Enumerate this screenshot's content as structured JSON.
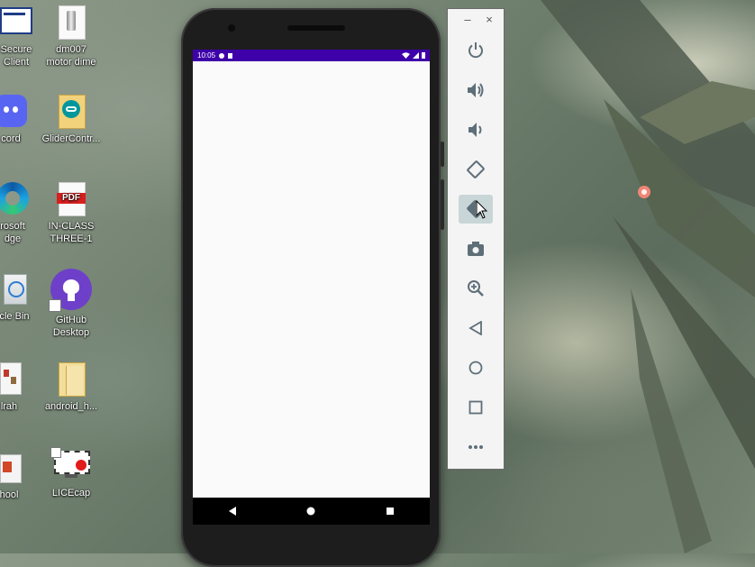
{
  "desktop": {
    "icons": [
      {
        "label_line1": "Secure",
        "label_line2": "Client",
        "icon": "cisco-vpn-icon"
      },
      {
        "label_line1": "dm007",
        "label_line2": "motor dime",
        "icon": "motor-file-icon"
      },
      {
        "label_line1": "cord",
        "label_line2": "",
        "icon": "discord-icon"
      },
      {
        "label_line1": "GliderContr...",
        "label_line2": "",
        "icon": "arduino-folder-icon"
      },
      {
        "label_line1": "rosoft",
        "label_line2": "dge",
        "icon": "edge-icon"
      },
      {
        "label_line1": "IN-CLASS",
        "label_line2": "THREE-1",
        "icon": "pdf-icon"
      },
      {
        "label_line1": "cle Bin",
        "label_line2": "",
        "icon": "recycle-bin-icon"
      },
      {
        "label_line1": "GitHub",
        "label_line2": "Desktop",
        "icon": "github-icon"
      },
      {
        "label_line1": "lrah",
        "label_line2": "",
        "icon": "document-stack-icon"
      },
      {
        "label_line1": "android_h...",
        "label_line2": "",
        "icon": "folder-icon"
      },
      {
        "label_line1": "hool",
        "label_line2": "",
        "icon": "school-folder-icon"
      },
      {
        "label_line1": "LICEcap",
        "label_line2": "",
        "icon": "licecap-icon"
      }
    ]
  },
  "phone": {
    "status": {
      "time": "10:05"
    },
    "colors": {
      "status_bar": "#3e00a8",
      "screen_bg": "#fafafa",
      "nav_bar": "#000000"
    },
    "nav": {
      "back": "back-icon",
      "home": "home-icon",
      "recents": "recents-icon"
    }
  },
  "emulator_toolbar": {
    "minimize": "–",
    "close": "×",
    "buttons": [
      {
        "name": "power-icon"
      },
      {
        "name": "volume-up-icon"
      },
      {
        "name": "volume-down-icon"
      },
      {
        "name": "rotate-left-icon"
      },
      {
        "name": "rotate-right-icon"
      },
      {
        "name": "camera-icon"
      },
      {
        "name": "zoom-icon"
      },
      {
        "name": "back-icon"
      },
      {
        "name": "home-icon"
      },
      {
        "name": "overview-icon"
      },
      {
        "name": "more-icon"
      }
    ]
  }
}
